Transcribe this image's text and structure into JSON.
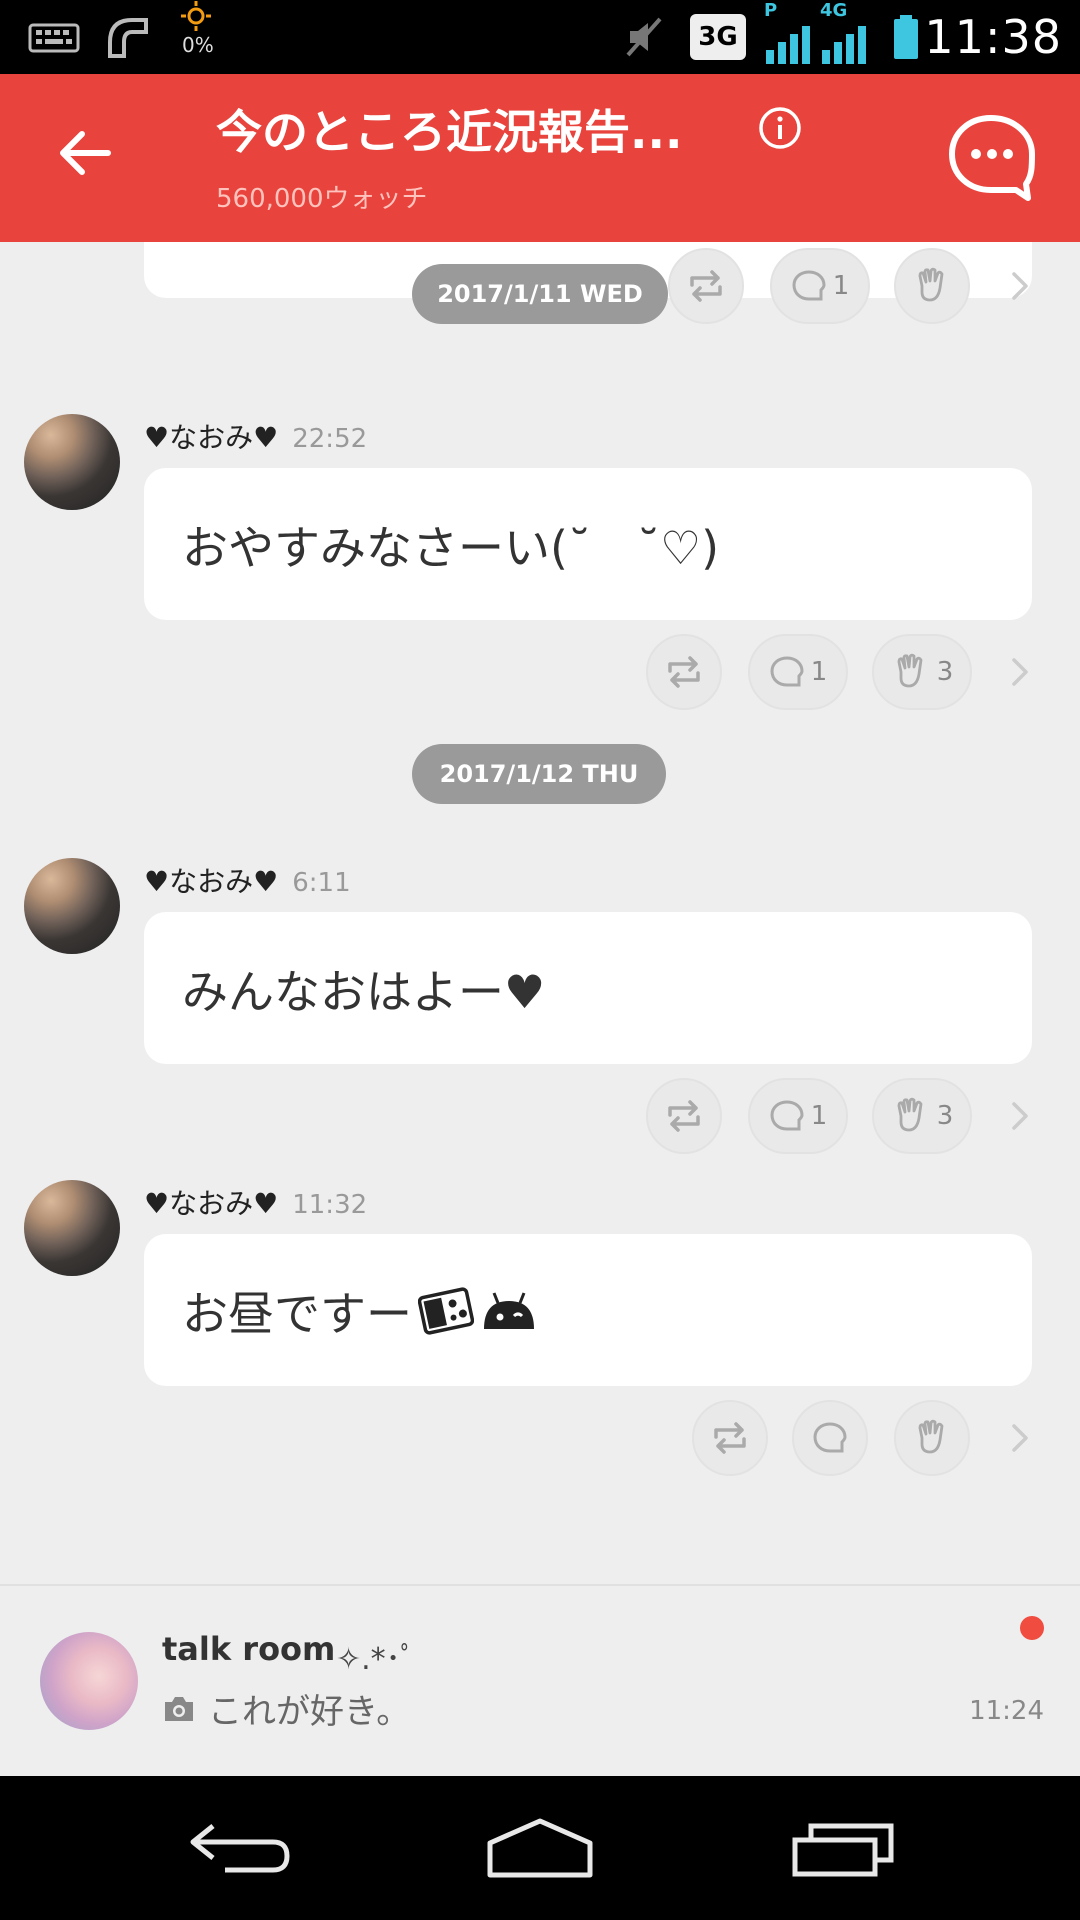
{
  "status_bar": {
    "time": "11:38",
    "battery_percent": "0%",
    "network": "3G",
    "network_alt": "4G",
    "carrier_flag": "P"
  },
  "header": {
    "title": "今のところ近況報告...",
    "subtitle": "560,000ウォッチ",
    "back_icon": "arrow-left-icon",
    "info_icon": "info-icon",
    "talk_icon": "chat-bubble-icon",
    "color": "#e8433c"
  },
  "feed": {
    "prev_actions": {
      "comments": "1",
      "claps": ""
    },
    "date_1": "2017/1/11 WED",
    "date_2": "2017/1/12 THU",
    "posts": [
      {
        "author": "♥なおみ♥",
        "time": "22:52",
        "text": "おやすみなさーい(˘　˘♡)",
        "comments": "1",
        "claps": "3"
      },
      {
        "author": "♥なおみ♥",
        "time": "6:11",
        "text": "みんなおはよー♥",
        "comments": "1",
        "claps": "3"
      },
      {
        "author": "♥なおみ♥",
        "time": "11:32",
        "text": "お昼ですー",
        "comments": "",
        "claps": ""
      }
    ]
  },
  "talk_room": {
    "title": "talk room",
    "decoration": "✧.*･ﾟ",
    "message": "これが好き。",
    "time": "11:24",
    "unread_color": "#f04c3f"
  },
  "nav": {
    "back": "nav-back-icon",
    "home": "nav-home-icon",
    "recents": "nav-recents-icon"
  }
}
